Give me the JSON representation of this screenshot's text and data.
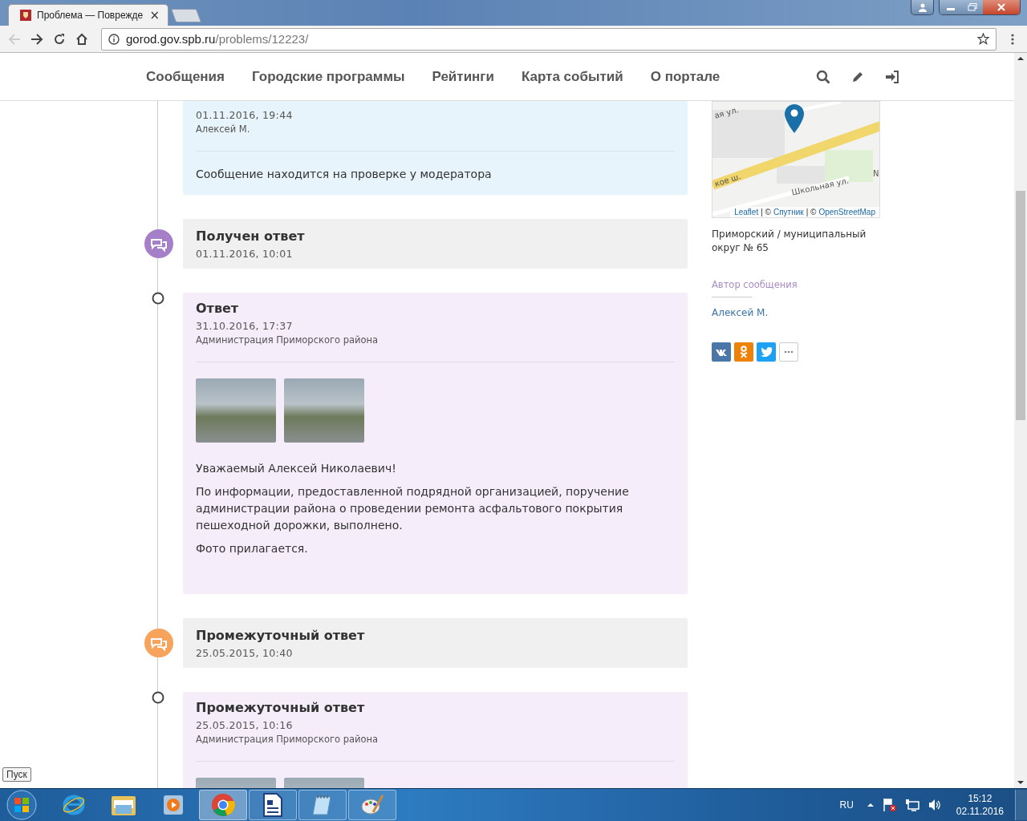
{
  "browser": {
    "tab_title": "Проблема — Поврежде",
    "tab_close": "×",
    "url_host": "gorod.gov.spb.ru",
    "url_path": "/problems/12223/"
  },
  "nav": {
    "items": [
      "Сообщения",
      "Городские программы",
      "Рейтинги",
      "Карта событий",
      "О портале"
    ]
  },
  "timeline": [
    {
      "kind": "message",
      "date": "01.11.2016, 19:44",
      "author": "Алексей М.",
      "text": "Сообщение находится на проверке у модератора"
    },
    {
      "kind": "status",
      "color": "#a67fc9",
      "title": "Получен ответ",
      "date": "01.11.2016, 10:01"
    },
    {
      "kind": "reply",
      "title": "Ответ",
      "date": "31.10.2016, 17:37",
      "author": "Администрация Приморского района",
      "photos": [
        {
          "kind": "photo"
        },
        {
          "kind": "photo"
        }
      ],
      "paragraphs": [
        "Уважаемый Алексей Николаевич!",
        "По информации, предоставленной подрядной организацией, поручение администрации района о проведении ремонта асфальтового покрытия пешеходной дорожки, выполнено.",
        "Фото прилагается."
      ]
    },
    {
      "kind": "status",
      "color": "#f7a35c",
      "title": "Промежуточный ответ",
      "date": "25.05.2015, 10:40"
    },
    {
      "kind": "reply",
      "title": "Промежуточный ответ",
      "date": "25.05.2015, 10:16",
      "author": "Администрация Приморского района",
      "photos": [
        {
          "kind": "photo"
        },
        {
          "kind": "photo"
        }
      ]
    }
  ],
  "sidebar": {
    "map_labels": [
      "ая ул.",
      "кое ш.",
      "Школьная ул.",
      "N"
    ],
    "map_attribution": [
      {
        "text": "Leaflet",
        "link": true
      },
      {
        "text": "| ©",
        "link": false
      },
      {
        "text": "Спутник",
        "link": true
      },
      {
        "text": "| ©",
        "link": false
      },
      {
        "text": "OpenStreetMap",
        "link": true
      }
    ],
    "district": "Приморский / муниципальный округ № 65",
    "author_label": "Автор сообщения",
    "author": "Алексей М.",
    "share": [
      {
        "kind": "vk"
      },
      {
        "kind": "ok"
      },
      {
        "kind": "twitter"
      },
      {
        "kind": "more"
      }
    ]
  },
  "taskbar": {
    "start_tooltip": "Пуск",
    "apps": [
      {
        "kind": "ie",
        "running": false,
        "selected": false
      },
      {
        "kind": "explorer",
        "running": false,
        "selected": false
      },
      {
        "kind": "media",
        "running": false,
        "selected": false
      },
      {
        "kind": "chrome",
        "running": true,
        "selected": true
      },
      {
        "kind": "writer",
        "running": true,
        "selected": false
      },
      {
        "kind": "notepad",
        "running": true,
        "selected": false
      },
      {
        "kind": "paint",
        "running": true,
        "selected": false
      }
    ],
    "lang": "RU",
    "time": "15:12",
    "date": "02.11.2016"
  }
}
